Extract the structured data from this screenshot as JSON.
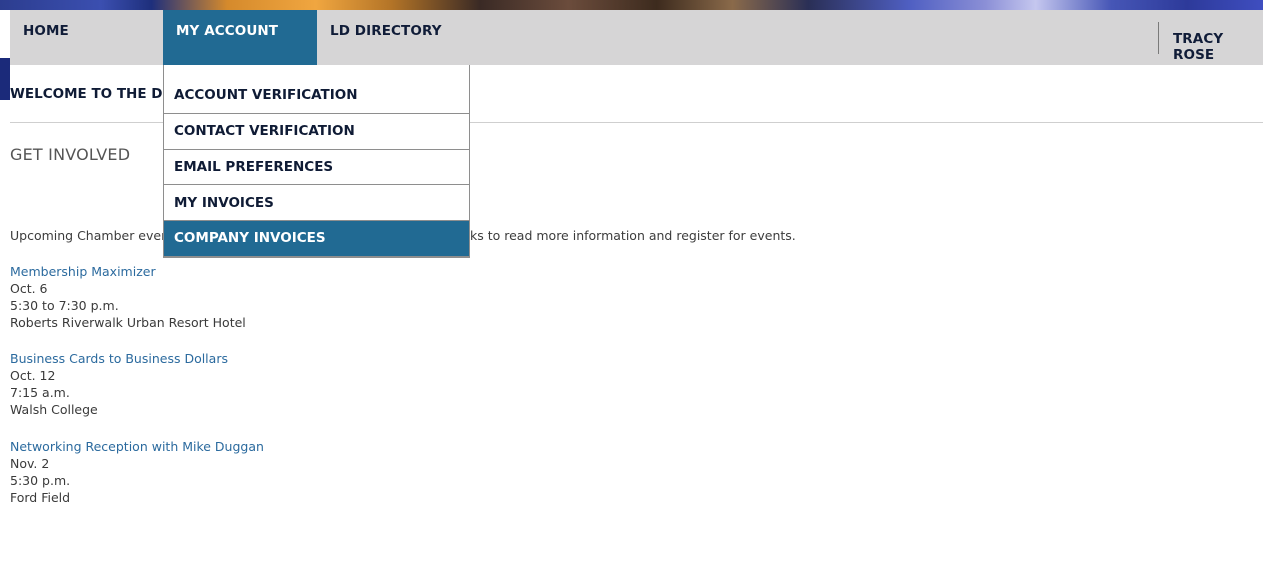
{
  "nav": {
    "home": "HOME",
    "my_account": "MY ACCOUNT",
    "ld_directory": "LD DIRECTORY",
    "user_name": "TRACY ROSE"
  },
  "account_menu": {
    "items": [
      {
        "label": "ACCOUNT VERIFICATION"
      },
      {
        "label": "CONTACT VERIFICATION"
      },
      {
        "label": "EMAIL PREFERENCES"
      },
      {
        "label": "MY INVOICES"
      },
      {
        "label": "COMPANY INVOICES",
        "highlighted": true
      }
    ]
  },
  "page": {
    "welcome_visible": "WELCOME TO THE DET",
    "section_title": "GET INVOLVED",
    "intro_left": "Upcoming Chamber event",
    "intro_right": "ks to read more information and register for events."
  },
  "events": [
    {
      "title": "Membership Maximizer",
      "date": "Oct. 6",
      "time": "5:30 to 7:30 p.m.",
      "location": "Roberts Riverwalk Urban Resort Hotel"
    },
    {
      "title": "Business Cards to Business Dollars",
      "date": "Oct. 12",
      "time": "7:15 a.m.",
      "location": "Walsh College"
    },
    {
      "title": "Networking Reception with Mike Duggan",
      "date": "Nov. 2",
      "time": "5:30 p.m.",
      "location": "Ford Field"
    }
  ],
  "colors": {
    "nav_bg": "#d6d5d6",
    "accent": "#216a93",
    "link": "#2b6a9e",
    "nav_text": "#101c38"
  }
}
